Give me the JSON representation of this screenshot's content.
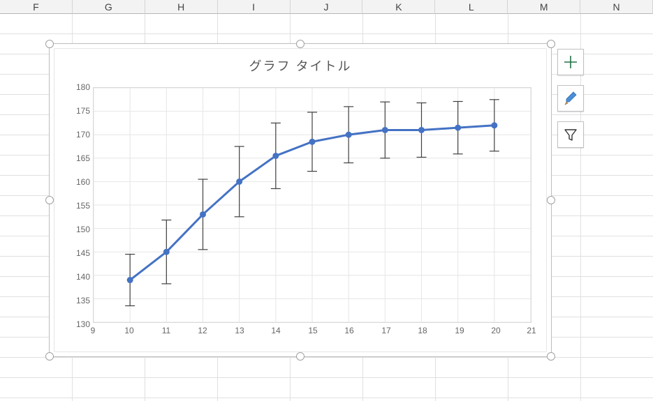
{
  "columns": [
    "F",
    "G",
    "H",
    "I",
    "J",
    "K",
    "L",
    "M",
    "N"
  ],
  "chart_title": "グラフ タイトル",
  "y_ticks": [
    130,
    135,
    140,
    145,
    150,
    155,
    160,
    165,
    170,
    175,
    180
  ],
  "x_ticks": [
    9,
    10,
    11,
    12,
    13,
    14,
    15,
    16,
    17,
    18,
    19,
    20,
    21
  ],
  "colors": {
    "series": "#4472C4",
    "grid": "#e6e6e6",
    "error_bar": "#404040"
  },
  "chart_data": {
    "type": "line",
    "title": "グラフ タイトル",
    "xlabel": "",
    "ylabel": "",
    "xlim": [
      9,
      21
    ],
    "ylim": [
      130,
      180
    ],
    "x": [
      10,
      11,
      12,
      13,
      14,
      15,
      16,
      17,
      18,
      19,
      20
    ],
    "y": [
      139,
      145,
      153,
      160,
      165.5,
      168.5,
      170,
      171,
      171,
      171.5,
      172
    ],
    "error_y": [
      5.5,
      6.8,
      7.5,
      7.5,
      7.0,
      6.3,
      6.0,
      6.0,
      5.8,
      5.6,
      5.5
    ]
  }
}
